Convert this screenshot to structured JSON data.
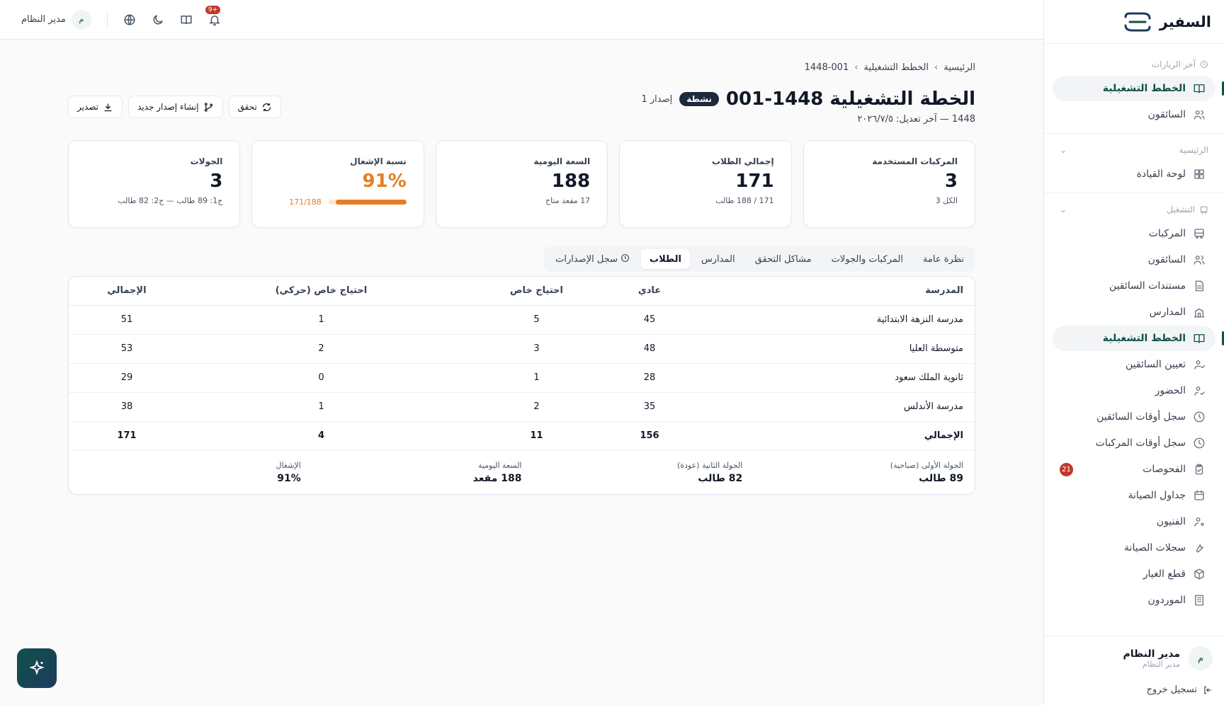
{
  "brand": {
    "name": "السفير"
  },
  "topbar": {
    "notifications_badge": "9+",
    "user_initial": "م",
    "user_name": "مدير النظام"
  },
  "sidebar": {
    "recent_header": "آخر الزيارات",
    "recent_items": [
      {
        "label": "الخطط التشغيلية",
        "icon": "book-icon",
        "active": true
      },
      {
        "label": "السائقون",
        "icon": "users-icon",
        "active": false
      }
    ],
    "home_header": "الرئيسية",
    "home_items": [
      {
        "label": "لوحة القيادة",
        "icon": "dashboard-icon",
        "active": false
      }
    ],
    "ops_header": "التشغيل",
    "ops_items": [
      {
        "label": "المركبات",
        "icon": "bus-icon",
        "active": false
      },
      {
        "label": "السائقون",
        "icon": "users-icon",
        "active": false
      },
      {
        "label": "مستندات السائقين",
        "icon": "document-icon",
        "active": false
      },
      {
        "label": "المدارس",
        "icon": "school-icon",
        "active": false
      },
      {
        "label": "الخطط التشغيلية",
        "icon": "book-icon",
        "active": true
      },
      {
        "label": "تعيين السائقين",
        "icon": "user-assign-icon",
        "active": false
      },
      {
        "label": "الحضور",
        "icon": "attendance-icon",
        "active": false
      },
      {
        "label": "سجل أوقات السائقين",
        "icon": "clock-icon",
        "active": false
      },
      {
        "label": "سجل أوقات المركبات",
        "icon": "clock-icon",
        "active": false
      },
      {
        "label": "الفحوصات",
        "icon": "clipboard-icon",
        "active": false,
        "badge": "21"
      },
      {
        "label": "جداول الصيانة",
        "icon": "calendar-icon",
        "active": false
      },
      {
        "label": "الفنيون",
        "icon": "user-gear-icon",
        "active": false
      },
      {
        "label": "سجلات الصيانة",
        "icon": "wrench-icon",
        "active": false
      },
      {
        "label": "قطع الغيار",
        "icon": "box-icon",
        "active": false
      },
      {
        "label": "الموردون",
        "icon": "building-icon",
        "active": false
      }
    ],
    "footer": {
      "user_initial": "م",
      "user_name": "مدير النظام",
      "user_role": "مدير النظام",
      "logout_label": "تسجيل خروج"
    }
  },
  "breadcrumb": {
    "home": "الرئيسية",
    "section": "الخطط التشغيلية",
    "current": "1448-001"
  },
  "header": {
    "title": "الخطة التشغيلية 1448-001",
    "status": "نشطة",
    "version": "إصدار 1",
    "subtitle": "1448 — آخر تعديل: ٢٠٢٦/٧/٥"
  },
  "actions": {
    "verify": "تحقق",
    "new_version": "إنشاء إصدار جديد",
    "export": "تصدير"
  },
  "stats": {
    "vehicles": {
      "label": "المركبات المستخدمة",
      "value": "3",
      "sub": "الكل 3"
    },
    "students": {
      "label": "إجمالي الطلاب",
      "value": "171",
      "sub": "171 / 188 طالب"
    },
    "capacity": {
      "label": "السعة اليومية",
      "value": "188",
      "sub": "17 مقعد متاح"
    },
    "occupancy": {
      "label": "نسبة الإشغال",
      "value": "91%",
      "progress_text": "171/188",
      "progress_fraction": 0.91
    },
    "trips": {
      "label": "الجولات",
      "value": "3",
      "sub": "ج1: 89 طالب — ج2: 82 طالب"
    }
  },
  "tabs": [
    {
      "label": "نظرة عامة",
      "active": false
    },
    {
      "label": "المركبات والجولات",
      "active": false
    },
    {
      "label": "مشاكل التحقق",
      "active": false
    },
    {
      "label": "المدارس",
      "active": false
    },
    {
      "label": "الطلاب",
      "active": true
    },
    {
      "label": "سجل الإصدارات",
      "active": false
    }
  ],
  "table": {
    "headers": [
      "المدرسة",
      "عادي",
      "احتياج خاص",
      "احتياج خاص (حركي)",
      "الإجمالي"
    ],
    "rows": [
      [
        "مدرسة النزهة الابتدائية",
        "45",
        "5",
        "1",
        "51"
      ],
      [
        "متوسطة العليا",
        "48",
        "3",
        "2",
        "53"
      ],
      [
        "ثانوية الملك سعود",
        "28",
        "1",
        "0",
        "29"
      ],
      [
        "مدرسة الأندلس",
        "35",
        "2",
        "1",
        "38"
      ]
    ],
    "total": [
      "الإجمالي",
      "156",
      "11",
      "4",
      "171"
    ]
  },
  "summary": [
    {
      "label": "الجولة الأولى (صباحية)",
      "value": "89 طالب"
    },
    {
      "label": "الجولة الثانية (عودة)",
      "value": "82 طالب"
    },
    {
      "label": "السعة اليومية",
      "value": "188 مقعد"
    },
    {
      "label": "الإشغال",
      "value": "91%"
    }
  ],
  "colors": {
    "brand": "#0f5249",
    "accent": "#e67e22",
    "danger": "#c0392b"
  }
}
